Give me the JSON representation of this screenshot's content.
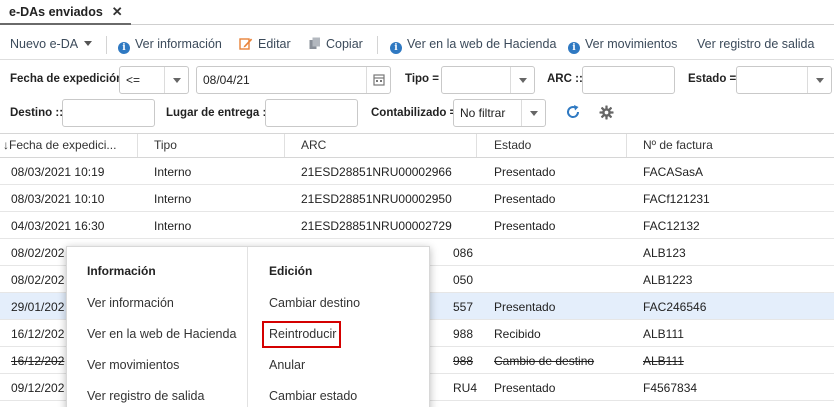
{
  "tab": {
    "label": "e-DAs enviados",
    "close": "✕"
  },
  "toolbar": {
    "nuevo": "Nuevo e-DA",
    "ver_info": "Ver información",
    "editar": "Editar",
    "copiar": "Copiar",
    "ver_web": "Ver en la web de Hacienda",
    "ver_mov": "Ver movimientos",
    "ver_registro": "Ver registro de salida"
  },
  "filters": {
    "fecha_label": "Fecha de expedición",
    "fecha_op": "<=",
    "fecha_value": "08/04/21",
    "tipo_label": "Tipo =",
    "arc_label": "ARC ::",
    "estado_label": "Estado =",
    "destino_label": "Destino ::",
    "lugar_label": "Lugar de entrega ::",
    "contab_label": "Contabilizado =",
    "contab_value": "No filtrar"
  },
  "grid": {
    "headers": [
      "↓Fecha de expedici...",
      "Tipo",
      "ARC",
      "Estado",
      "Nº de factura"
    ],
    "rows": [
      [
        "08/03/2021 10:19",
        "Interno",
        "21ESD28851NRU00002966",
        "Presentado",
        "FACASasA"
      ],
      [
        "08/03/2021 10:10",
        "Interno",
        "21ESD28851NRU00002950",
        "Presentado",
        "FACf121231"
      ],
      [
        "04/03/2021 16:30",
        "Interno",
        "21ESD28851NRU00002729",
        "Presentado",
        "FAC12132"
      ],
      [
        "08/02/202",
        "",
        "086",
        "",
        "ALB123"
      ],
      [
        "08/02/202",
        "",
        "050",
        "",
        "ALB1223"
      ],
      [
        "29/01/202",
        "",
        "557",
        "Presentado",
        "FAC246546"
      ],
      [
        "16/12/202",
        "",
        "988",
        "Recibido",
        "ALB111"
      ],
      [
        "16/12/202",
        "",
        "988",
        "Cambio de destino",
        "ALB111"
      ],
      [
        "09/12/202",
        "",
        "RU4",
        "Presentado",
        "F4567834"
      ]
    ]
  },
  "context_menu": {
    "info_title": "Información",
    "info_items": [
      "Ver información",
      "Ver en la web de Hacienda",
      "Ver movimientos",
      "Ver registro de salida"
    ],
    "edit_title": "Edición",
    "edit_items": [
      "Cambiar destino",
      "Reintroducir",
      "Anular",
      "Cambiar estado"
    ]
  },
  "colors": {
    "accent": "#2f79c2",
    "edit_icon": "#e8833a",
    "highlight": "#d40000",
    "selected_row": "#e4eefb"
  }
}
